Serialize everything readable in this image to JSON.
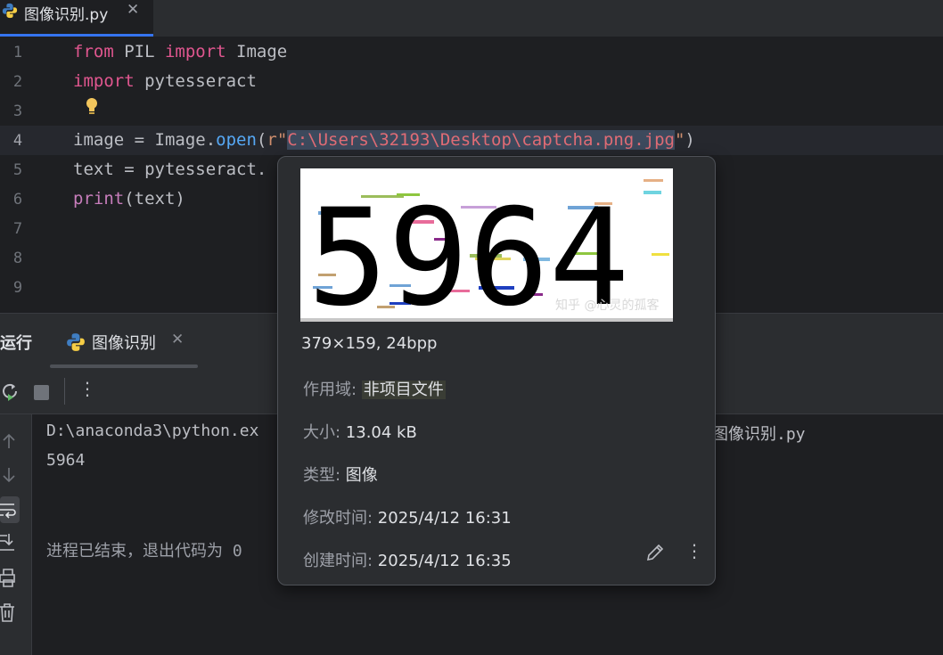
{
  "tab": {
    "label": "图像识别.py",
    "close": "✕"
  },
  "editor": {
    "line_numbers": [
      "1",
      "2",
      "3",
      "4",
      "5",
      "6",
      "7",
      "8",
      "9"
    ],
    "lines": {
      "l1": {
        "kw1": "from",
        "mod": " PIL ",
        "kw2": "import",
        "name": " Image"
      },
      "l2": {
        "kw": "import",
        "name": " pytesseract"
      },
      "l4": {
        "a": "image = Image.",
        "fn": "open",
        "b": "(",
        "prefix": "r\"",
        "path": "C:\\Users\\32193\\Desktop\\captcha.png.jpg",
        "quote": "\"",
        "c": ")"
      },
      "l5": {
        "a": "text = pytesseract."
      },
      "l6": {
        "fn": "print",
        "a": "(text)"
      }
    }
  },
  "run_panel": {
    "title": "运行",
    "tab_label": "图像识别",
    "tab_close": "✕",
    "more": "⋮",
    "console": {
      "cmd_start": "D:\\anaconda3\\python.ex",
      "cmd_end": "图像识别.py",
      "output": "5964",
      "exit": "进程已结束，退出代码为 0"
    }
  },
  "popup": {
    "image_text": "5964",
    "watermark": "知乎 @心灵的孤客",
    "dims": "379×159, 24bpp",
    "scope_label": "作用域: ",
    "scope_value": "非项目文件",
    "size_label": "大小: ",
    "size_value": "13.04 kB",
    "type_label": "类型: ",
    "type_value": "图像",
    "modified_label": "修改时间: ",
    "modified_value": "2025/4/12 16:31",
    "created_label": "创建时间: ",
    "created_value": "2025/4/12 16:35",
    "more": "⋮"
  },
  "colors": {
    "accent": "#3574f0",
    "keyword": "#cf8e6d",
    "string": "#6aab73",
    "background": "#1e1f22",
    "panel": "#2b2d30"
  },
  "icons": [
    "python-icon",
    "close-icon",
    "bulb-icon",
    "rerun-icon",
    "stop-icon",
    "more-icon",
    "arrow-up-icon",
    "arrow-down-icon",
    "soft-wrap-icon",
    "scroll-end-icon",
    "print-icon",
    "trash-icon",
    "pencil-icon"
  ]
}
